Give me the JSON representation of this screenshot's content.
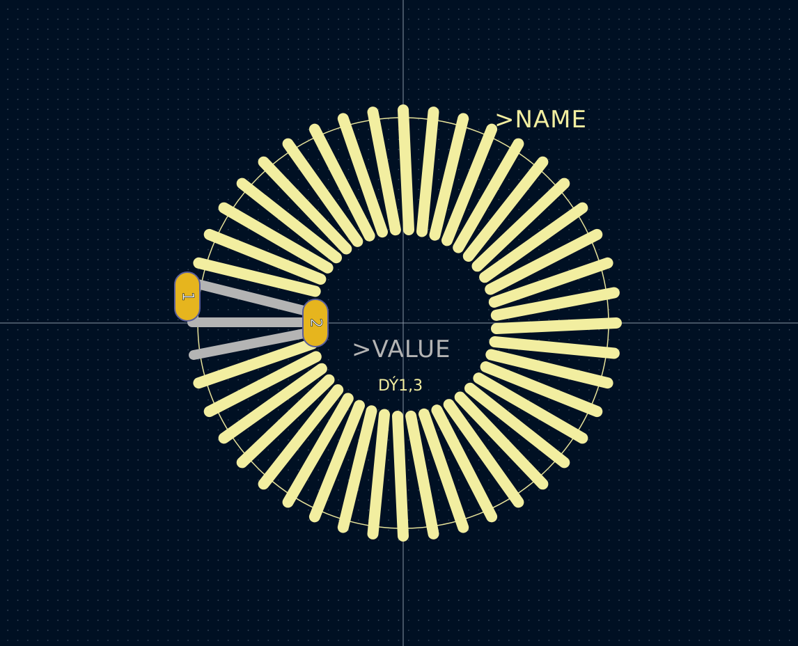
{
  "labels": {
    "name": ">NAME",
    "value": ">VALUE",
    "designator": "DÝ1,3"
  },
  "pads": [
    {
      "number": "1"
    },
    {
      "number": "2"
    }
  ],
  "colors": {
    "background": "#001023",
    "grid_dot": "#3a4a5e",
    "crosshair": "#8a96a6",
    "silkscreen": "#f2eea0",
    "outline": "#e6e29a",
    "pad": "#e6b51e",
    "pad_outline": "#5a5e9a",
    "wire": "#b4b4b4",
    "value_text": "#b4b4b4"
  },
  "icons": {
    "pad": "oval-pad-icon",
    "winding": "winding-icon"
  }
}
